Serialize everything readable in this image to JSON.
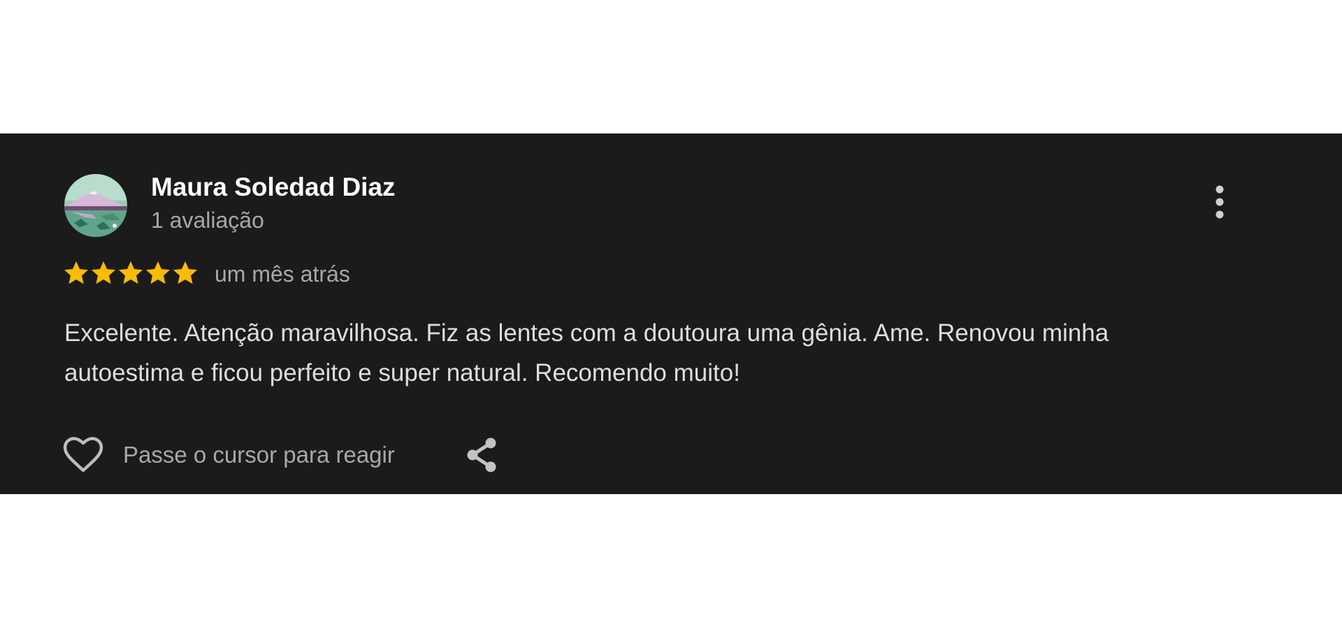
{
  "review": {
    "author": {
      "name": "Maura Soledad Diaz",
      "meta": "1 avaliação",
      "avatar_icon": "landscape-avatar"
    },
    "rating": 5,
    "rating_max": 5,
    "date": "um mês atrás",
    "text": "Excelente. Atenção maravilhosa. Fiz as lentes com a doutoura uma gênia. Ame. Renovou minha autoestima e ficou perfeito e super natural. Recomendo muito!",
    "actions": {
      "like_label": "Passe o cursor para reagir",
      "like_icon": "heart-outline-icon",
      "share_icon": "share-icon",
      "more_icon": "more-vertical-icon"
    }
  },
  "colors": {
    "card_background": "#1b1b1b",
    "page_background": "#ffffff",
    "name": "#ffffff",
    "secondary_text": "#a8a8a8",
    "body_text": "#dedede",
    "star": "#fbbc04"
  }
}
